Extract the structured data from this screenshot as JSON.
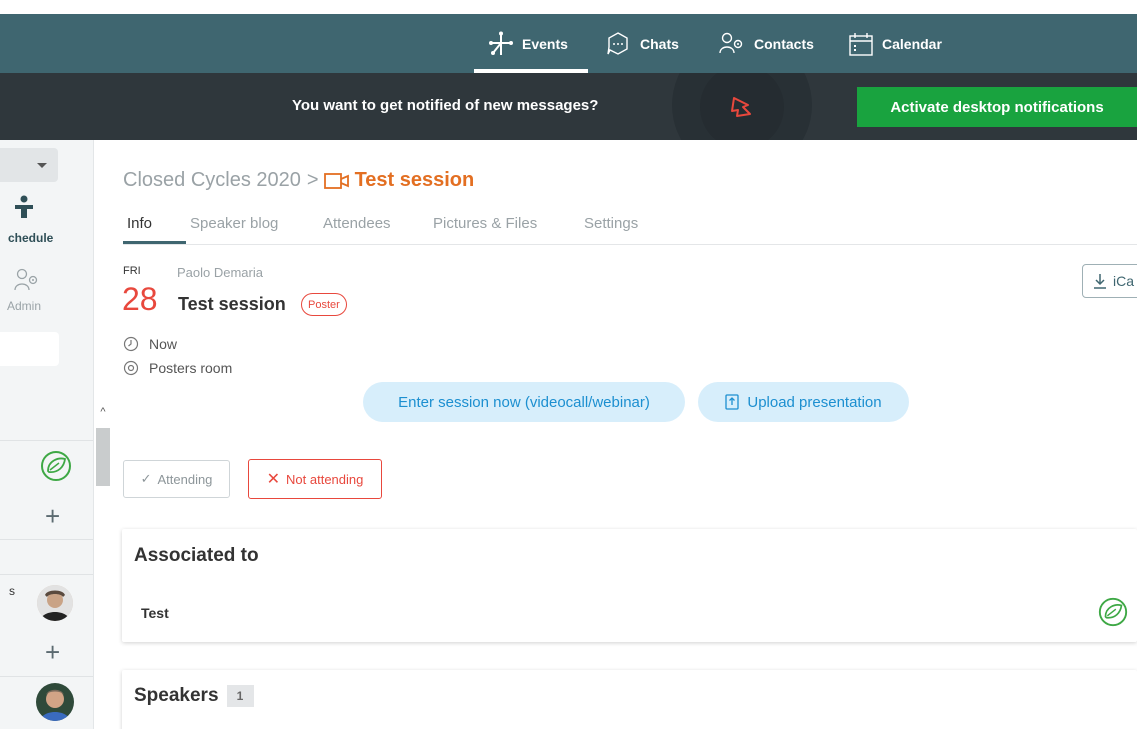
{
  "nav": {
    "items": [
      {
        "label": "Events",
        "icon": "events-icon",
        "active": true
      },
      {
        "label": "Chats",
        "icon": "chat-bubble-icon",
        "active": false
      },
      {
        "label": "Contacts",
        "icon": "contacts-icon",
        "active": false
      },
      {
        "label": "Calendar",
        "icon": "calendar-icon",
        "active": false
      }
    ]
  },
  "notification": {
    "message": "You want to get notified of new messages?",
    "button_label": "Activate desktop notifications"
  },
  "sidebar": {
    "schedule_label": "chedule",
    "admin_label": "Admin",
    "speaker_initial": "s"
  },
  "breadcrumb": {
    "root": "Closed Cycles 2020",
    "separator": ">",
    "current": "Test session"
  },
  "tabs": [
    "Info",
    "Speaker blog",
    "Attendees",
    "Pictures & Files",
    "Settings"
  ],
  "session": {
    "day": "FRI",
    "date": "28",
    "speaker": "Paolo Demaria",
    "title": "Test session",
    "badge": "Poster",
    "time": "Now",
    "room": "Posters room",
    "ical_label": "iCa"
  },
  "actions": {
    "enter_label": "Enter session now (videocall/webinar)",
    "upload_label": "Upload presentation",
    "attending_label": "Attending",
    "not_attending_label": "Not attending"
  },
  "associated": {
    "title": "Associated to",
    "item": "Test"
  },
  "speakers": {
    "title": "Speakers",
    "count": "1"
  },
  "colors": {
    "nav_bg": "#3f6670",
    "notif_bg": "#2f373c",
    "activate_green": "#19a33f",
    "accent_orange": "#e36f22",
    "accent_red": "#e8483d",
    "pill_blue_bg": "#d7eefb",
    "pill_blue_text": "#1c8fd0"
  }
}
